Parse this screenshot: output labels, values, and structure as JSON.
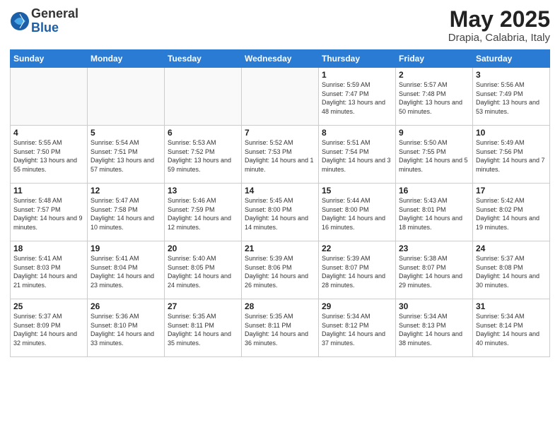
{
  "header": {
    "logo": {
      "general": "General",
      "blue": "Blue"
    },
    "title": "May 2025",
    "location": "Drapia, Calabria, Italy"
  },
  "weekdays": [
    "Sunday",
    "Monday",
    "Tuesday",
    "Wednesday",
    "Thursday",
    "Friday",
    "Saturday"
  ],
  "weeks": [
    [
      {
        "day": "",
        "info": ""
      },
      {
        "day": "",
        "info": ""
      },
      {
        "day": "",
        "info": ""
      },
      {
        "day": "",
        "info": ""
      },
      {
        "day": "1",
        "sunrise": "Sunrise: 5:59 AM",
        "sunset": "Sunset: 7:47 PM",
        "daylight": "Daylight: 13 hours and 48 minutes."
      },
      {
        "day": "2",
        "sunrise": "Sunrise: 5:57 AM",
        "sunset": "Sunset: 7:48 PM",
        "daylight": "Daylight: 13 hours and 50 minutes."
      },
      {
        "day": "3",
        "sunrise": "Sunrise: 5:56 AM",
        "sunset": "Sunset: 7:49 PM",
        "daylight": "Daylight: 13 hours and 53 minutes."
      }
    ],
    [
      {
        "day": "4",
        "sunrise": "Sunrise: 5:55 AM",
        "sunset": "Sunset: 7:50 PM",
        "daylight": "Daylight: 13 hours and 55 minutes."
      },
      {
        "day": "5",
        "sunrise": "Sunrise: 5:54 AM",
        "sunset": "Sunset: 7:51 PM",
        "daylight": "Daylight: 13 hours and 57 minutes."
      },
      {
        "day": "6",
        "sunrise": "Sunrise: 5:53 AM",
        "sunset": "Sunset: 7:52 PM",
        "daylight": "Daylight: 13 hours and 59 minutes."
      },
      {
        "day": "7",
        "sunrise": "Sunrise: 5:52 AM",
        "sunset": "Sunset: 7:53 PM",
        "daylight": "Daylight: 14 hours and 1 minute."
      },
      {
        "day": "8",
        "sunrise": "Sunrise: 5:51 AM",
        "sunset": "Sunset: 7:54 PM",
        "daylight": "Daylight: 14 hours and 3 minutes."
      },
      {
        "day": "9",
        "sunrise": "Sunrise: 5:50 AM",
        "sunset": "Sunset: 7:55 PM",
        "daylight": "Daylight: 14 hours and 5 minutes."
      },
      {
        "day": "10",
        "sunrise": "Sunrise: 5:49 AM",
        "sunset": "Sunset: 7:56 PM",
        "daylight": "Daylight: 14 hours and 7 minutes."
      }
    ],
    [
      {
        "day": "11",
        "sunrise": "Sunrise: 5:48 AM",
        "sunset": "Sunset: 7:57 PM",
        "daylight": "Daylight: 14 hours and 9 minutes."
      },
      {
        "day": "12",
        "sunrise": "Sunrise: 5:47 AM",
        "sunset": "Sunset: 7:58 PM",
        "daylight": "Daylight: 14 hours and 10 minutes."
      },
      {
        "day": "13",
        "sunrise": "Sunrise: 5:46 AM",
        "sunset": "Sunset: 7:59 PM",
        "daylight": "Daylight: 14 hours and 12 minutes."
      },
      {
        "day": "14",
        "sunrise": "Sunrise: 5:45 AM",
        "sunset": "Sunset: 8:00 PM",
        "daylight": "Daylight: 14 hours and 14 minutes."
      },
      {
        "day": "15",
        "sunrise": "Sunrise: 5:44 AM",
        "sunset": "Sunset: 8:00 PM",
        "daylight": "Daylight: 14 hours and 16 minutes."
      },
      {
        "day": "16",
        "sunrise": "Sunrise: 5:43 AM",
        "sunset": "Sunset: 8:01 PM",
        "daylight": "Daylight: 14 hours and 18 minutes."
      },
      {
        "day": "17",
        "sunrise": "Sunrise: 5:42 AM",
        "sunset": "Sunset: 8:02 PM",
        "daylight": "Daylight: 14 hours and 19 minutes."
      }
    ],
    [
      {
        "day": "18",
        "sunrise": "Sunrise: 5:41 AM",
        "sunset": "Sunset: 8:03 PM",
        "daylight": "Daylight: 14 hours and 21 minutes."
      },
      {
        "day": "19",
        "sunrise": "Sunrise: 5:41 AM",
        "sunset": "Sunset: 8:04 PM",
        "daylight": "Daylight: 14 hours and 23 minutes."
      },
      {
        "day": "20",
        "sunrise": "Sunrise: 5:40 AM",
        "sunset": "Sunset: 8:05 PM",
        "daylight": "Daylight: 14 hours and 24 minutes."
      },
      {
        "day": "21",
        "sunrise": "Sunrise: 5:39 AM",
        "sunset": "Sunset: 8:06 PM",
        "daylight": "Daylight: 14 hours and 26 minutes."
      },
      {
        "day": "22",
        "sunrise": "Sunrise: 5:39 AM",
        "sunset": "Sunset: 8:07 PM",
        "daylight": "Daylight: 14 hours and 28 minutes."
      },
      {
        "day": "23",
        "sunrise": "Sunrise: 5:38 AM",
        "sunset": "Sunset: 8:07 PM",
        "daylight": "Daylight: 14 hours and 29 minutes."
      },
      {
        "day": "24",
        "sunrise": "Sunrise: 5:37 AM",
        "sunset": "Sunset: 8:08 PM",
        "daylight": "Daylight: 14 hours and 30 minutes."
      }
    ],
    [
      {
        "day": "25",
        "sunrise": "Sunrise: 5:37 AM",
        "sunset": "Sunset: 8:09 PM",
        "daylight": "Daylight: 14 hours and 32 minutes."
      },
      {
        "day": "26",
        "sunrise": "Sunrise: 5:36 AM",
        "sunset": "Sunset: 8:10 PM",
        "daylight": "Daylight: 14 hours and 33 minutes."
      },
      {
        "day": "27",
        "sunrise": "Sunrise: 5:35 AM",
        "sunset": "Sunset: 8:11 PM",
        "daylight": "Daylight: 14 hours and 35 minutes."
      },
      {
        "day": "28",
        "sunrise": "Sunrise: 5:35 AM",
        "sunset": "Sunset: 8:11 PM",
        "daylight": "Daylight: 14 hours and 36 minutes."
      },
      {
        "day": "29",
        "sunrise": "Sunrise: 5:34 AM",
        "sunset": "Sunset: 8:12 PM",
        "daylight": "Daylight: 14 hours and 37 minutes."
      },
      {
        "day": "30",
        "sunrise": "Sunrise: 5:34 AM",
        "sunset": "Sunset: 8:13 PM",
        "daylight": "Daylight: 14 hours and 38 minutes."
      },
      {
        "day": "31",
        "sunrise": "Sunrise: 5:34 AM",
        "sunset": "Sunset: 8:14 PM",
        "daylight": "Daylight: 14 hours and 40 minutes."
      }
    ]
  ]
}
